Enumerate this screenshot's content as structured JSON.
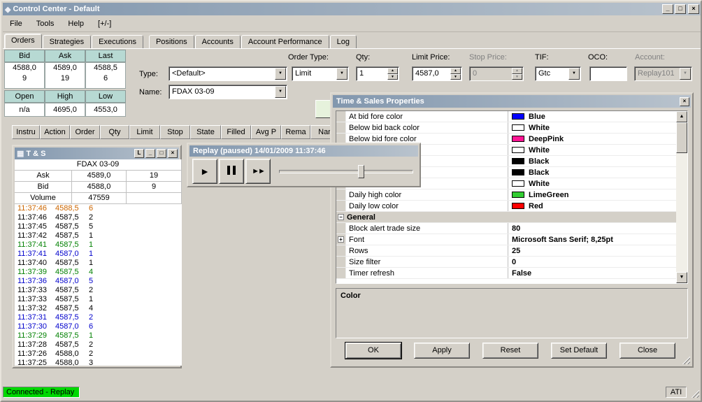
{
  "icons": {
    "app": "◆",
    "minimize": "_",
    "maximize": "□",
    "close": "×",
    "dropdown_arrow": "▼",
    "spin_up": "▲",
    "spin_down": "▼",
    "scroll_up": "▲",
    "scroll_down": "▼",
    "play": "►",
    "fast_forward": "►►",
    "ts_window": "▦",
    "expand_plus": "+",
    "collapse_minus": "−"
  },
  "titlebar": {
    "title": "Control Center - Default"
  },
  "menubar": {
    "items": [
      "File",
      "Tools",
      "Help",
      "[+/-]"
    ]
  },
  "tabs": {
    "items": [
      "Orders",
      "Strategies",
      "Executions",
      "Positions",
      "Accounts",
      "Account Performance",
      "Log"
    ]
  },
  "market_panel": {
    "headers_top": [
      "Bid",
      "Ask",
      "Last"
    ],
    "prices": [
      "4588,0",
      "4589,0",
      "4588,5"
    ],
    "sizes": [
      "9",
      "19",
      "6"
    ],
    "headers_bottom": [
      "Open",
      "High",
      "Low"
    ],
    "values_bottom": [
      "n/a",
      "4695,0",
      "4553,0"
    ]
  },
  "order_form": {
    "type_label": "Type:",
    "type_value": "<Default>",
    "name_label": "Name:",
    "name_value": "FDAX 03-09",
    "order_type_label": "Order Type:",
    "order_type_value": "Limit",
    "qty_label": "Qty:",
    "qty_value": "1",
    "limit_price_label": "Limit Price:",
    "limit_price_value": "4587,0",
    "stop_price_label": "Stop Price:",
    "stop_price_value": "0",
    "tif_label": "TIF:",
    "tif_value": "Gtc",
    "oco_label": "OCO:",
    "oco_value": "",
    "account_label": "Account:",
    "account_value": "Replay101"
  },
  "orders_grid": {
    "columns": [
      "Instru",
      "Action",
      "Order",
      "Qty",
      "Limit",
      "Stop",
      "State",
      "Filled",
      "Avg P",
      "Rema",
      "Nar"
    ]
  },
  "ts_window": {
    "title": "T & S",
    "corner_button": "L",
    "instrument": "FDAX 03-09",
    "ask_label": "Ask",
    "ask_price": "4589,0",
    "ask_size": "19",
    "bid_label": "Bid",
    "bid_price": "4588,0",
    "bid_size": "9",
    "volume_label": "Volume",
    "volume_value": "47559",
    "trades": [
      {
        "time": "11:37:46",
        "price": "4588,5",
        "size": "6",
        "color": "#cc6600"
      },
      {
        "time": "11:37:46",
        "price": "4587,5",
        "size": "2",
        "color": "#000000"
      },
      {
        "time": "11:37:45",
        "price": "4587,5",
        "size": "5",
        "color": "#000000"
      },
      {
        "time": "11:37:42",
        "price": "4587,5",
        "size": "1",
        "color": "#000000"
      },
      {
        "time": "11:37:41",
        "price": "4587,5",
        "size": "1",
        "color": "#008000"
      },
      {
        "time": "11:37:41",
        "price": "4587,0",
        "size": "1",
        "color": "#0000cc"
      },
      {
        "time": "11:37:40",
        "price": "4587,5",
        "size": "1",
        "color": "#000000"
      },
      {
        "time": "11:37:39",
        "price": "4587,5",
        "size": "4",
        "color": "#008000"
      },
      {
        "time": "11:37:36",
        "price": "4587,0",
        "size": "5",
        "color": "#0000cc"
      },
      {
        "time": "11:37:33",
        "price": "4587,5",
        "size": "2",
        "color": "#000000"
      },
      {
        "time": "11:37:33",
        "price": "4587,5",
        "size": "1",
        "color": "#000000"
      },
      {
        "time": "11:37:32",
        "price": "4587,5",
        "size": "4",
        "color": "#000000"
      },
      {
        "time": "11:37:31",
        "price": "4587,5",
        "size": "2",
        "color": "#0000cc"
      },
      {
        "time": "11:37:30",
        "price": "4587,0",
        "size": "6",
        "color": "#0000cc"
      },
      {
        "time": "11:37:29",
        "price": "4587,5",
        "size": "1",
        "color": "#008000"
      },
      {
        "time": "11:37:28",
        "price": "4587,5",
        "size": "2",
        "color": "#000000"
      },
      {
        "time": "11:37:26",
        "price": "4588,0",
        "size": "2",
        "color": "#000000"
      },
      {
        "time": "11:37:25",
        "price": "4588,0",
        "size": "3",
        "color": "#000000"
      }
    ]
  },
  "replay": {
    "title": "Replay (paused) 14/01/2009 11:37:46",
    "slider_position": "59%"
  },
  "properties_dialog": {
    "title": "Time & Sales Properties",
    "color_rows": [
      {
        "label": "At bid fore color",
        "value": "Blue",
        "swatch": "#0000ff"
      },
      {
        "label": "Below bid back color",
        "value": "White",
        "swatch": "#ffffff"
      },
      {
        "label": "Below bid fore color",
        "value": "DeepPink",
        "swatch": "#ff1493"
      },
      {
        "label": "",
        "value": "White",
        "swatch": "#ffffff"
      },
      {
        "label": "",
        "value": "Black",
        "swatch": "#000000"
      },
      {
        "label": "",
        "value": "Black",
        "swatch": "#000000"
      },
      {
        "label": "",
        "value": "White",
        "swatch": "#ffffff"
      },
      {
        "label": "Daily high color",
        "value": "LimeGreen",
        "swatch": "#32cd32"
      },
      {
        "label": "Daily low color",
        "value": "Red",
        "swatch": "#ff0000"
      }
    ],
    "category_label": "General",
    "general_rows": [
      {
        "label": "Block alert trade size",
        "value": "80"
      },
      {
        "label": "Font",
        "value": "Microsoft Sans Serif; 8,25pt"
      },
      {
        "label": "Rows",
        "value": "25"
      },
      {
        "label": "Size filter",
        "value": "0"
      },
      {
        "label": "Timer refresh",
        "value": "False"
      }
    ],
    "description_title": "Color",
    "buttons": [
      "OK",
      "Apply",
      "Reset",
      "Set Default",
      "Close"
    ]
  },
  "statusbar": {
    "left": "Connected - Replay",
    "right": "ATI"
  },
  "colors": {
    "status_green": "#00d800",
    "header_teal": "#b7d9d3"
  }
}
